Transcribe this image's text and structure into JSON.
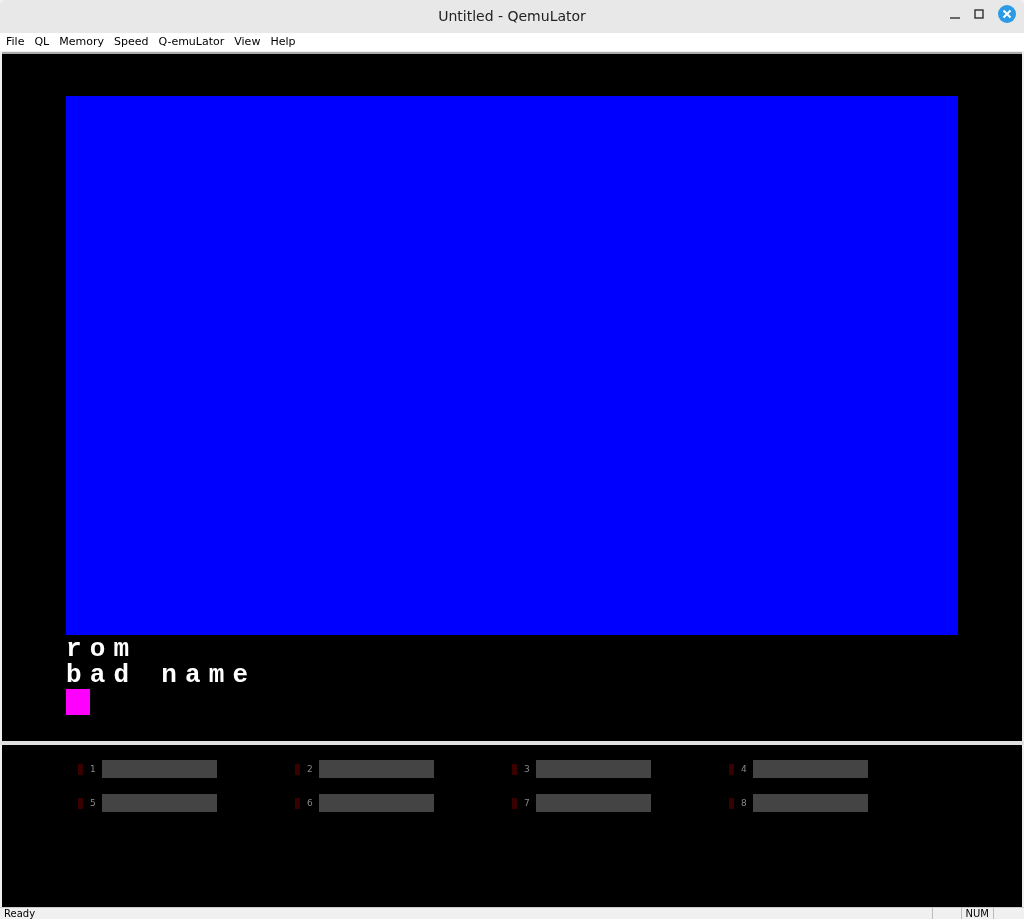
{
  "window": {
    "title": "Untitled - QemuLator"
  },
  "menu": [
    "File",
    "QL",
    "Memory",
    "Speed",
    "Q-emuLator",
    "View",
    "Help"
  ],
  "screen": {
    "lines": [
      "rom",
      "bad name"
    ],
    "cursor": true
  },
  "drives": [
    {
      "label": "1",
      "on": false
    },
    {
      "label": "2",
      "on": false
    },
    {
      "label": "3",
      "on": false
    },
    {
      "label": "4",
      "on": false
    },
    {
      "label": "5",
      "on": false
    },
    {
      "label": "6",
      "on": false
    },
    {
      "label": "7",
      "on": false
    },
    {
      "label": "8",
      "on": false
    }
  ],
  "status_bar": {
    "text": "Ready",
    "indicators": [
      "NUM"
    ]
  }
}
